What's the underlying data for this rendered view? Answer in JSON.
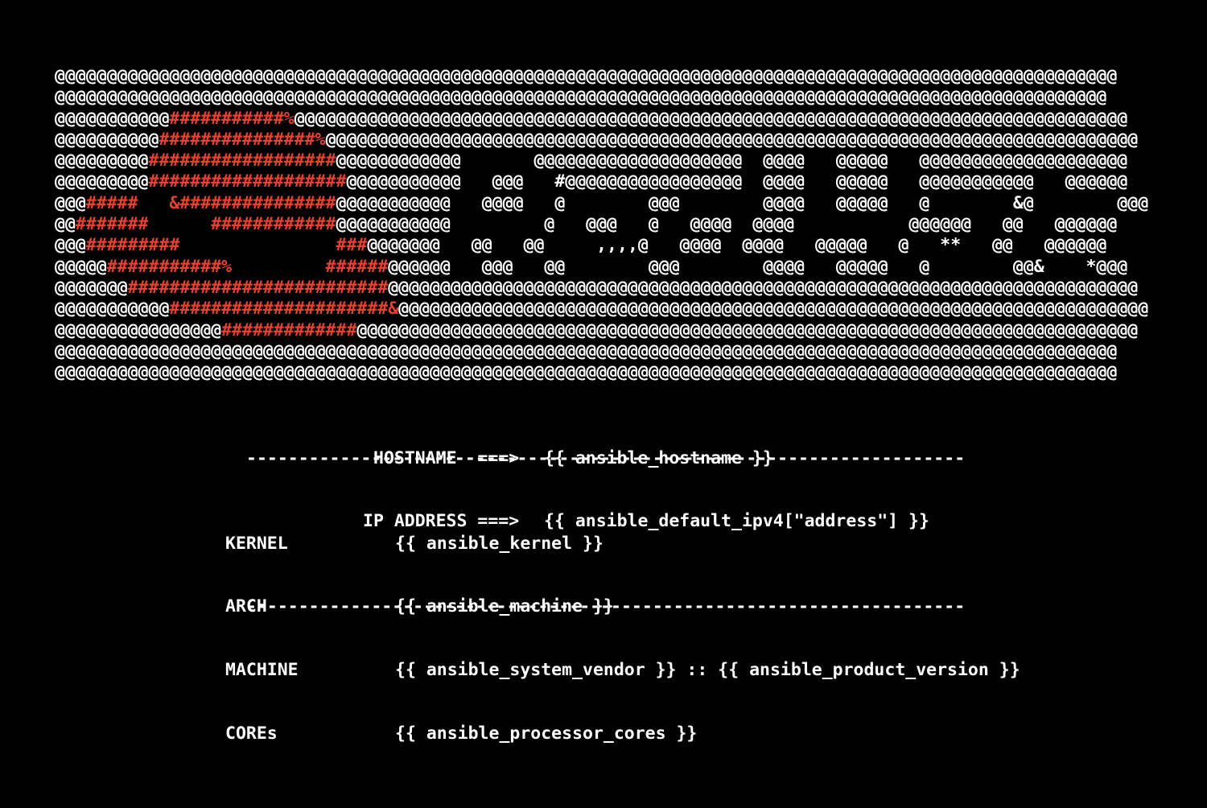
{
  "colors": {
    "background": "#000000",
    "text": "#ffffff",
    "accent_red": "#e8412f"
  },
  "banner": {
    "lines": [
      [
        {
          "t": "@@@@@@@@@@@@@@@@@@@@@@@@@@@@@@@@@@@@@@@@@@@@@@@@@@@@@@@@@@@@@@@@@@@@@@@@@@@@@@@@@@@@@@@@@@@@@@@@@@@@@@",
          "c": "w"
        }
      ],
      [
        {
          "t": "@@@@@@@@@@@@@@@@@@@@@@@@@@@@@@@@@@@@@@@@@@@@@@@@@@@@@@@@@@@@@@@@@@@@@@@@@@@@@@@@@@@@@@@@@@@@@@@@@@@@@",
          "c": "w"
        }
      ],
      [
        {
          "t": "@@@@@@@@@@@",
          "c": "w"
        },
        {
          "t": "###########%",
          "c": "r"
        },
        {
          "t": "@@@@@@@@@@@@@@@@@@@@@@@@@@@@@@@@@@@@@@@@@@@@@@@@@@@@@@@@@@@@@@@@@@@@@@@@@@@@@@@@",
          "c": "w"
        }
      ],
      [
        {
          "t": "@@@@@@@@@@",
          "c": "w"
        },
        {
          "t": "###############%",
          "c": "r"
        },
        {
          "t": "@@@@@@@@@@@@@@@@@@@@@@@@@@@@@@@@@@@@@@@@@@@@@@@@@@@@@@@@@@@@@@@@@@@@@@@@@@@@@@",
          "c": "w"
        }
      ],
      [
        {
          "t": "@@@@@@@@@",
          "c": "w"
        },
        {
          "t": "##################",
          "c": "r"
        },
        {
          "t": "@@@@@@@@@@@@       @@@@@@@@@@@@@@@@@@@@  @@@@   @@@@@   @@@@@@@@@@@@@@@@@@@@",
          "c": "w"
        }
      ],
      [
        {
          "t": "@@@@@@@@@",
          "c": "w"
        },
        {
          "t": "###################",
          "c": "r"
        },
        {
          "t": "@@@@@@@@@@@   @@@   #@@@@@@@@@@@@@@@@@  @@@@   @@@@@   @@@@@@@@@@@   @@@@@@",
          "c": "w"
        }
      ],
      [
        {
          "t": "@@@",
          "c": "w"
        },
        {
          "t": "#####   &###############",
          "c": "r"
        },
        {
          "t": "@@@@@@@@@@@   @@@@   @        @@@        @@@@   @@@@@   @        &@        @@@",
          "c": "w"
        }
      ],
      [
        {
          "t": "@@",
          "c": "w"
        },
        {
          "t": "#######      ############",
          "c": "r"
        },
        {
          "t": "@@@@@@@@@@@         @   @@@   @   @@@@  @@@@           @@@@@@   @@   @@@@@@",
          "c": "w"
        }
      ],
      [
        {
          "t": "@@@",
          "c": "w"
        },
        {
          "t": "#########               ###",
          "c": "r"
        },
        {
          "t": "@@@@@@@   @@   @@     ,,,,@   @@@@  @@@@   @@@@@   @   **   @@   @@@@@@",
          "c": "w"
        }
      ],
      [
        {
          "t": "@@@@@",
          "c": "w"
        },
        {
          "t": "###########%         ######",
          "c": "r"
        },
        {
          "t": "@@@@@@   @@@   @@        @@@        @@@@   @@@@@   @        @@&    *@@@",
          "c": "w"
        }
      ],
      [
        {
          "t": "@@@@@@@",
          "c": "w"
        },
        {
          "t": "#########################",
          "c": "r"
        },
        {
          "t": "@@@@@@@@@@@@@@@@@@@@@@@@@@@@@@@@@@@@@@@@@@@@@@@@@@@@@@@@@@@@@@@@@@@@@@@@",
          "c": "w"
        }
      ],
      [
        {
          "t": "@@@@@@@@@@@",
          "c": "w"
        },
        {
          "t": "#####################&",
          "c": "r"
        },
        {
          "t": "@@@@@@@@@@@@@@@@@@@@@@@@@@@@@@@@@@@@@@@@@@@@@@@@@@@@@@@@@@@@@@@@@@@@@@@@",
          "c": "w"
        }
      ],
      [
        {
          "t": "@@@@@@@@@@@@@@@@",
          "c": "w"
        },
        {
          "t": "#############",
          "c": "r"
        },
        {
          "t": "@@@@@@@@@@@@@@@@@@@@@@@@@@@@@@@@@@@@@@@@@@@@@@@@@@@@@@@@@@@@@@@@@@@@@@@@@@@",
          "c": "w"
        }
      ],
      [
        {
          "t": "@@@@@@@@@@@@@@@@@@@@@@@@@@@@@@@@@@@@@@@@@@@@@@@@@@@@@@@@@@@@@@@@@@@@@@@@@@@@@@@@@@@@@@@@@@@@@@@@@@@@@@",
          "c": "w"
        }
      ],
      [
        {
          "t": "@@@@@@@@@@@@@@@@@@@@@@@@@@@@@@@@@@@@@@@@@@@@@@@@@@@@@@@@@@@@@@@@@@@@@@@@@@@@@@@@@@@@@@@@@@@@@@@@@@@@@@",
          "c": "w"
        }
      ]
    ]
  },
  "header": {
    "hostname_label": "HOSTNAME  ===>",
    "hostname_value": "{{ ansible_hostname }}",
    "ip_label": "IP ADDRESS ===>",
    "ip_value": "{{ ansible_default_ipv4[\"address\"] }}"
  },
  "divider": "---------------------------------------------------------------------",
  "facts": [
    {
      "label": "KERNEL",
      "value": "{{ ansible_kernel }}"
    },
    {
      "label": "ARCH",
      "value": "{{ ansible_machine }}"
    },
    {
      "label": "MACHINE",
      "value": "{{ ansible_system_vendor }} :: {{ ansible_product_version }}"
    },
    {
      "label": "COREs",
      "value": "{{ ansible_processor_cores }}"
    }
  ]
}
